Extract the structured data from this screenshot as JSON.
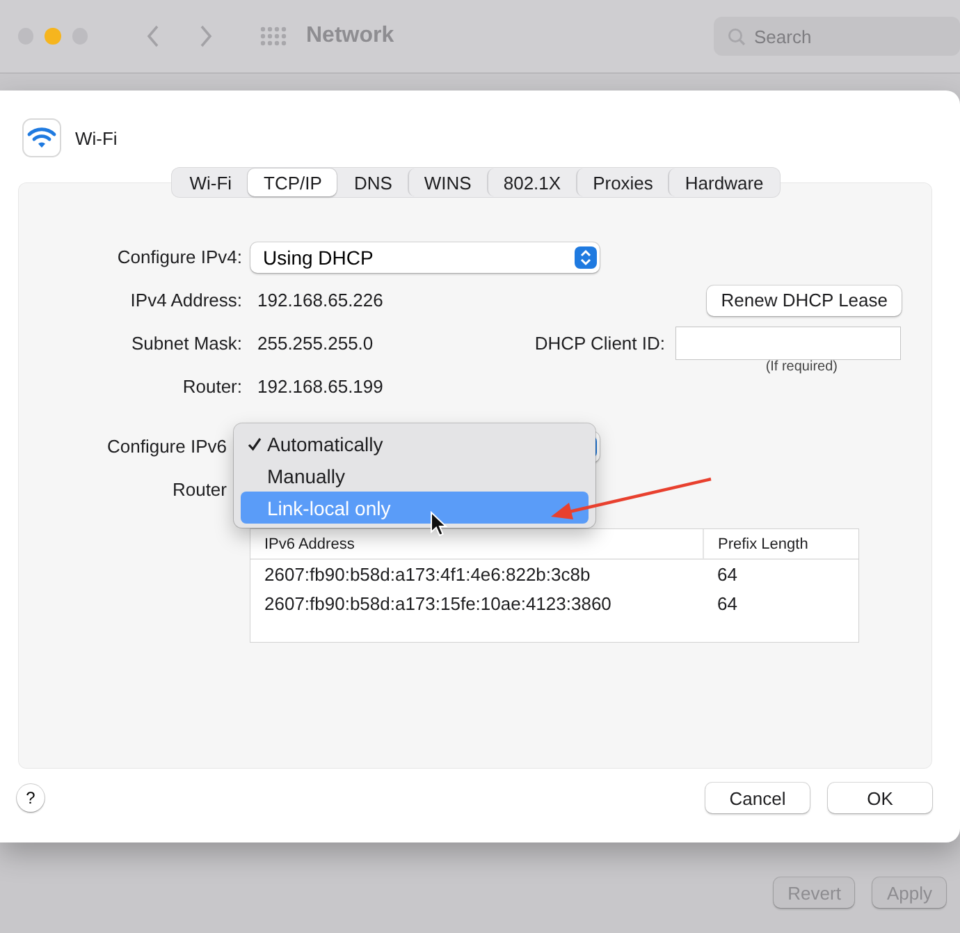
{
  "window": {
    "title": "Network",
    "search": {
      "placeholder": "Search"
    }
  },
  "sheet": {
    "service": "Wi-Fi",
    "tabs": [
      {
        "label": "Wi-Fi",
        "selected": false
      },
      {
        "label": "TCP/IP",
        "selected": true
      },
      {
        "label": "DNS",
        "selected": false
      },
      {
        "label": "WINS",
        "selected": false
      },
      {
        "label": "802.1X",
        "selected": false
      },
      {
        "label": "Proxies",
        "selected": false
      },
      {
        "label": "Hardware",
        "selected": false
      }
    ],
    "ipv4": {
      "label": "Configure IPv4:",
      "value": "Using DHCP"
    },
    "fields": [
      {
        "label": "IPv4 Address:",
        "value": "192.168.65.226"
      },
      {
        "label": "Subnet Mask:",
        "value": "255.255.255.0"
      },
      {
        "label": "Router:",
        "value": "192.168.65.199"
      }
    ],
    "renew_button": "Renew DHCP Lease",
    "client_id": {
      "label": "DHCP Client ID:",
      "note": "(If required)"
    },
    "ipv6": {
      "label": "Configure IPv6",
      "router_label": "Router"
    },
    "menu": {
      "items": [
        {
          "label": "Automatically",
          "checked": true,
          "selected": false
        },
        {
          "label": "Manually",
          "checked": false,
          "selected": false
        },
        {
          "label": "Link-local only",
          "checked": false,
          "selected": true
        }
      ]
    },
    "table": {
      "columns": [
        "IPv6 Address",
        "Prefix Length"
      ],
      "rows": [
        [
          "2607:fb90:b58d:a173:4f1:4e6:822b:3c8b",
          "64"
        ],
        [
          "2607:fb90:b58d:a173:15fe:10ae:4123:3860",
          "64"
        ]
      ]
    },
    "help_button": "?",
    "buttons": [
      "Cancel",
      "OK"
    ]
  },
  "footer": {
    "buttons": [
      "Revert",
      "Apply"
    ]
  }
}
